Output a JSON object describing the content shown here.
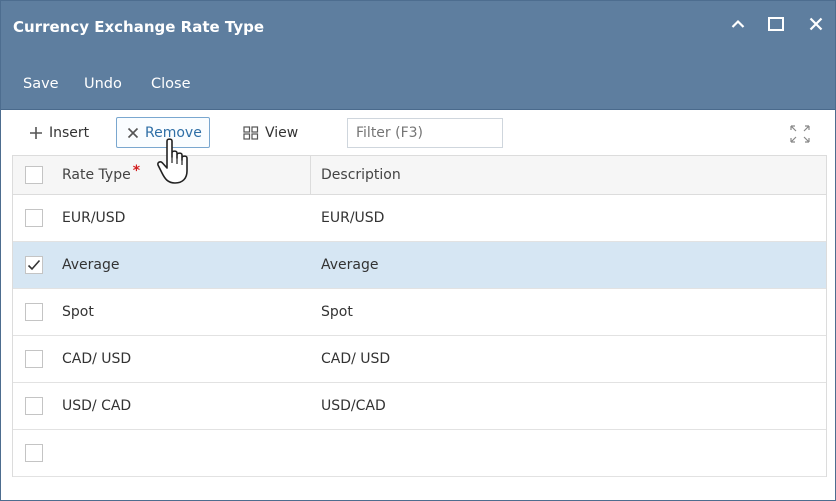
{
  "window": {
    "title": "Currency Exchange Rate Type"
  },
  "menu": {
    "save": "Save",
    "undo": "Undo",
    "close": "Close"
  },
  "toolbar": {
    "insert": "Insert",
    "remove": "Remove",
    "view": "View",
    "filter_placeholder": "Filter (F3)"
  },
  "grid": {
    "columns": {
      "rate_type": "Rate Type",
      "rate_type_required": "*",
      "description": "Description"
    },
    "rows": [
      {
        "rate_type": "EUR/USD",
        "description": "EUR/USD",
        "checked": false
      },
      {
        "rate_type": "Average",
        "description": "Average",
        "checked": true
      },
      {
        "rate_type": "Spot",
        "description": "Spot",
        "checked": false
      },
      {
        "rate_type": "CAD/ USD",
        "description": "CAD/ USD",
        "checked": false
      },
      {
        "rate_type": "USD/ CAD",
        "description": "USD/CAD",
        "checked": false
      },
      {
        "rate_type": "",
        "description": "",
        "checked": false
      }
    ]
  },
  "colors": {
    "titlebar": "#5e7e9f",
    "selected_row": "#d6e6f3",
    "required_mark": "#d21e1e"
  },
  "icons": {
    "collapse": "chevron-up-icon",
    "maximize": "maximize-icon",
    "close": "close-icon",
    "insert": "plus-icon",
    "remove": "x-icon",
    "view": "grid-view-icon",
    "expand": "expand-icon",
    "cursor": "hand-pointer-icon"
  }
}
